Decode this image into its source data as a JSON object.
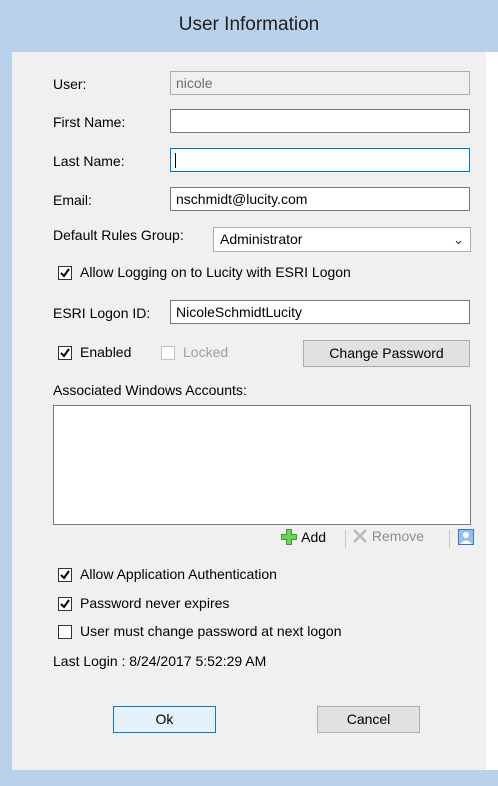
{
  "dialog": {
    "title": "User Information"
  },
  "form": {
    "user_label": "User:",
    "user_value": "nicole",
    "first_name_label": "First Name:",
    "first_name_value": "",
    "last_name_label": "Last Name:",
    "last_name_value": "",
    "email_label": "Email:",
    "email_value": "nschmidt@lucity.com",
    "rules_group_label": "Default Rules Group:",
    "rules_group_value": "Administrator",
    "esri_allow_label": "Allow Logging on to Lucity with ESRI Logon",
    "esri_allow_checked": true,
    "esri_id_label": "ESRI Logon ID:",
    "esri_id_value": "NicoleSchmidtLucity",
    "enabled_label": "Enabled",
    "enabled_checked": true,
    "locked_label": "Locked",
    "locked_checked": false,
    "change_password_label": "Change Password",
    "windows_accounts_label": "Associated Windows Accounts:",
    "add_label": "Add",
    "remove_label": "Remove",
    "allow_app_auth_label": "Allow Application Authentication",
    "allow_app_auth_checked": true,
    "pwd_never_expires_label": "Password never expires",
    "pwd_never_expires_checked": true,
    "must_change_pwd_label": "User must change password at next logon",
    "must_change_pwd_checked": false,
    "last_login": "Last Login : 8/24/2017 5:52:29 AM"
  },
  "buttons": {
    "ok": "Ok",
    "cancel": "Cancel"
  },
  "icons": {
    "add": "green-plus-icon",
    "remove": "x-icon",
    "browse": "user-picture-icon"
  }
}
